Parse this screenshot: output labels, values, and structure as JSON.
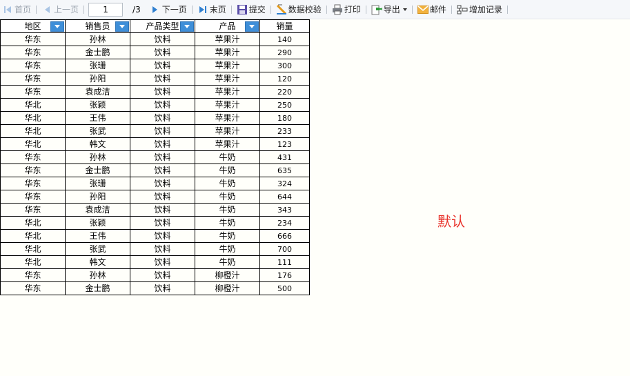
{
  "toolbar": {
    "first": "首页",
    "prev": "上一页",
    "page_value": "1",
    "page_total": "/3",
    "next": "下一页",
    "last": "末页",
    "submit": "提交",
    "validate": "数据校验",
    "print": "打印",
    "export": "导出",
    "mail": "邮件",
    "add_record": "增加记录"
  },
  "table": {
    "headers": [
      "地区",
      "销售员",
      "产品类型",
      "产品",
      "销量"
    ],
    "rows": [
      [
        "华东",
        "孙林",
        "饮料",
        "苹果汁",
        "140"
      ],
      [
        "华东",
        "金士鹏",
        "饮料",
        "苹果汁",
        "290"
      ],
      [
        "华东",
        "张珊",
        "饮料",
        "苹果汁",
        "300"
      ],
      [
        "华东",
        "孙阳",
        "饮料",
        "苹果汁",
        "120"
      ],
      [
        "华东",
        "袁成洁",
        "饮料",
        "苹果汁",
        "220"
      ],
      [
        "华北",
        "张颖",
        "饮料",
        "苹果汁",
        "250"
      ],
      [
        "华北",
        "王伟",
        "饮料",
        "苹果汁",
        "180"
      ],
      [
        "华北",
        "张武",
        "饮料",
        "苹果汁",
        "233"
      ],
      [
        "华北",
        "韩文",
        "饮料",
        "苹果汁",
        "123"
      ],
      [
        "华东",
        "孙林",
        "饮料",
        "牛奶",
        "431"
      ],
      [
        "华东",
        "金士鹏",
        "饮料",
        "牛奶",
        "635"
      ],
      [
        "华东",
        "张珊",
        "饮料",
        "牛奶",
        "324"
      ],
      [
        "华东",
        "孙阳",
        "饮料",
        "牛奶",
        "644"
      ],
      [
        "华东",
        "袁成洁",
        "饮料",
        "牛奶",
        "343"
      ],
      [
        "华北",
        "张颖",
        "饮料",
        "牛奶",
        "234"
      ],
      [
        "华北",
        "王伟",
        "饮料",
        "牛奶",
        "666"
      ],
      [
        "华北",
        "张武",
        "饮料",
        "牛奶",
        "700"
      ],
      [
        "华北",
        "韩文",
        "饮料",
        "牛奶",
        "111"
      ],
      [
        "华东",
        "孙林",
        "饮料",
        "柳橙汁",
        "176"
      ],
      [
        "华东",
        "金士鹏",
        "饮料",
        "柳橙汁",
        "500"
      ]
    ]
  },
  "default_label": "默认",
  "colors": {
    "filter_button": "#3e8ed8",
    "label_red": "#e8322a",
    "nav_blue": "#2f7fd0"
  }
}
